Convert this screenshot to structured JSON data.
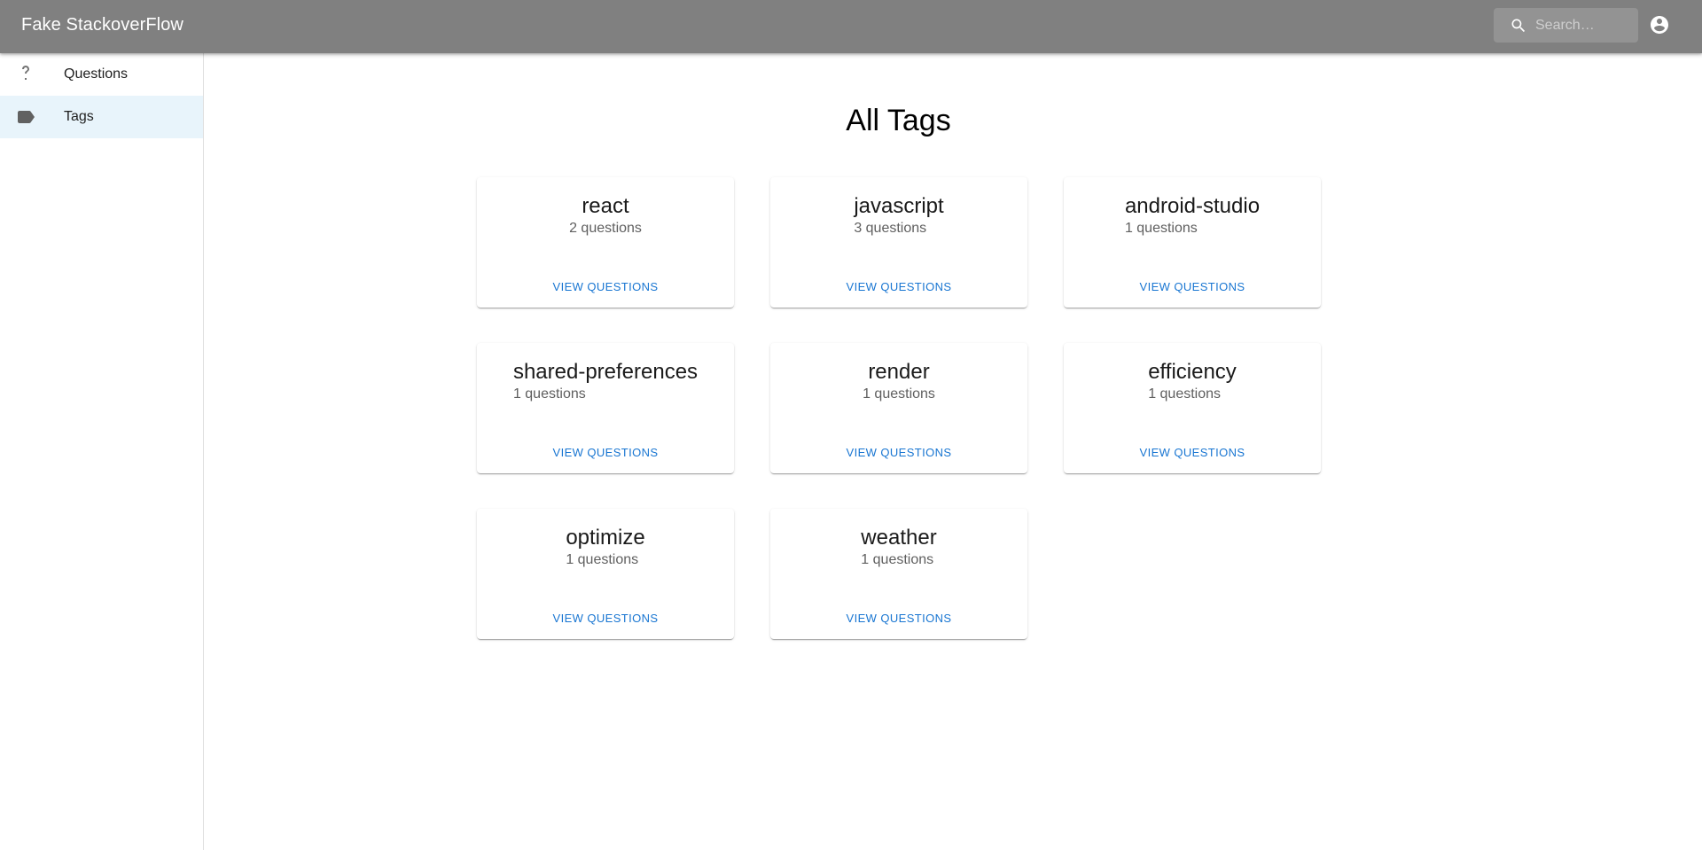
{
  "app": {
    "title": "Fake StackoverFlow",
    "bar_color": "#808080"
  },
  "search": {
    "placeholder": "Search…",
    "value": "",
    "icon": "search-icon"
  },
  "account": {
    "icon": "account-circle-icon"
  },
  "sidebar": {
    "items": [
      {
        "label": "Questions",
        "icon": "help-icon",
        "active": false
      },
      {
        "label": "Tags",
        "icon": "label-icon",
        "active": true
      }
    ],
    "active_color": "#e8f4fb"
  },
  "main": {
    "title": "All Tags",
    "button_color": "#1976d2",
    "tags": [
      {
        "name": "react",
        "count": "2 questions",
        "button": "VIEW QUESTIONS"
      },
      {
        "name": "javascript",
        "count": "3 questions",
        "button": "VIEW QUESTIONS"
      },
      {
        "name": "android-studio",
        "count": "1 questions",
        "button": "VIEW QUESTIONS"
      },
      {
        "name": "shared-preferences",
        "count": "1 questions",
        "button": "VIEW QUESTIONS"
      },
      {
        "name": "render",
        "count": "1 questions",
        "button": "VIEW QUESTIONS"
      },
      {
        "name": "efficiency",
        "count": "1 questions",
        "button": "VIEW QUESTIONS"
      },
      {
        "name": "optimize",
        "count": "1 questions",
        "button": "VIEW QUESTIONS"
      },
      {
        "name": "weather",
        "count": "1 questions",
        "button": "VIEW QUESTIONS"
      }
    ]
  }
}
